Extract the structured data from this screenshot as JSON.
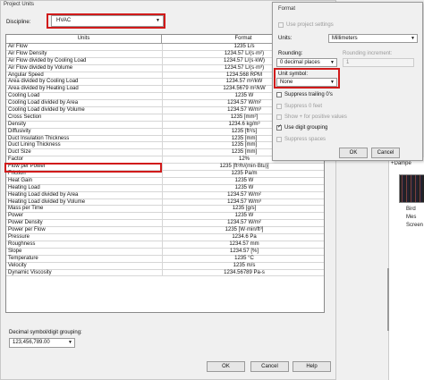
{
  "background_app": {
    "label": "+Dampe",
    "caption": [
      "Bird Mes",
      "Screen"
    ]
  },
  "project_units": {
    "title": "Project Units",
    "discipline_label": "Discipline:",
    "discipline_value": "HVAC",
    "table": {
      "headers": [
        "Units",
        "Format"
      ],
      "rows": [
        {
          "name": "Air Flow",
          "format": "1235 L/s"
        },
        {
          "name": "Air Flow Density",
          "format": "1234.57 L/(s·m²)"
        },
        {
          "name": "Air Flow divided by Cooling Load",
          "format": "1234.57 L/(s·kW)"
        },
        {
          "name": "Air Flow divided by Volume",
          "format": "1234.57 L/(s·m³)"
        },
        {
          "name": "Angular Speed",
          "format": "1234.568 RPM"
        },
        {
          "name": "Area divided by Cooling Load",
          "format": "1234.57 m²/kW"
        },
        {
          "name": "Area divided by Heating Load",
          "format": "1234.5679 m²/kW"
        },
        {
          "name": "Cooling Load",
          "format": "1235 W"
        },
        {
          "name": "Cooling Load divided by Area",
          "format": "1234.57 W/m²"
        },
        {
          "name": "Cooling Load divided by Volume",
          "format": "1234.57 W/m³"
        },
        {
          "name": "Cross Section",
          "format": "1235 [mm²]"
        },
        {
          "name": "Density",
          "format": "1234.6 kg/m³"
        },
        {
          "name": "Diffusivity",
          "format": "1235 [ft²/s]"
        },
        {
          "name": "Duct Insulation Thickness",
          "format": "1235 [mm]"
        },
        {
          "name": "Duct Lining Thickness",
          "format": "1235 [mm]"
        },
        {
          "name": "Duct Size",
          "format": "1235 [mm]"
        },
        {
          "name": "Factor",
          "format": "12%"
        },
        {
          "name": "Flow per Power",
          "format": "1235 [ft³/h/(min·Btu)]"
        },
        {
          "name": "Friction",
          "format": "1235 Pa/m"
        },
        {
          "name": "Heat Gain",
          "format": "1235 W"
        },
        {
          "name": "Heating Load",
          "format": "1235 W"
        },
        {
          "name": "Heating Load divided by Area",
          "format": "1234.57 W/m²"
        },
        {
          "name": "Heating Load divided by Volume",
          "format": "1234.57 W/m³"
        },
        {
          "name": "Mass per Time",
          "format": "1235 [g/s]"
        },
        {
          "name": "Power",
          "format": "1235 W"
        },
        {
          "name": "Power Density",
          "format": "1234.57 W/m²"
        },
        {
          "name": "Power per Flow",
          "format": "1235 [W·min/ft³]"
        },
        {
          "name": "Pressure",
          "format": "1234.6 Pa"
        },
        {
          "name": "Roughness",
          "format": "1234.57 mm"
        },
        {
          "name": "Slope",
          "format": "1234.57 [%]"
        },
        {
          "name": "Temperature",
          "format": "1235 °C"
        },
        {
          "name": "Velocity",
          "format": "1235 m/s"
        },
        {
          "name": "Dynamic Viscosity",
          "format": "1234.56789 Pa-s"
        }
      ]
    },
    "digit_grouping_label": "Decimal symbol/digit grouping:",
    "digit_grouping_value": "123,456,789.00",
    "buttons": {
      "ok": "OK",
      "cancel": "Cancel",
      "help": "Help"
    }
  },
  "format_dialog": {
    "title": "Format",
    "use_project_settings": "Use project settings",
    "units_label": "Units:",
    "units_value": "Millimeters",
    "rounding_label": "Rounding:",
    "rounding_value": "0 decimal places",
    "rounding_increment_label": "Rounding increment:",
    "rounding_increment_value": "1",
    "unit_symbol_label": "Unit symbol:",
    "unit_symbol_value": "None",
    "options": [
      {
        "label": "Suppress trailing 0's",
        "checked": false,
        "disabled": false
      },
      {
        "label": "Suppress 0 feet",
        "checked": false,
        "disabled": true
      },
      {
        "label": "Show + for positive values",
        "checked": false,
        "disabled": true
      },
      {
        "label": "Use digit grouping",
        "checked": true,
        "disabled": false
      },
      {
        "label": "Suppress spaces",
        "checked": false,
        "disabled": true
      }
    ],
    "buttons": {
      "ok": "OK",
      "cancel": "Cancel"
    }
  },
  "colors": {
    "highlight": "#d11a1a",
    "dialog_bg": "#f0f0f0"
  }
}
